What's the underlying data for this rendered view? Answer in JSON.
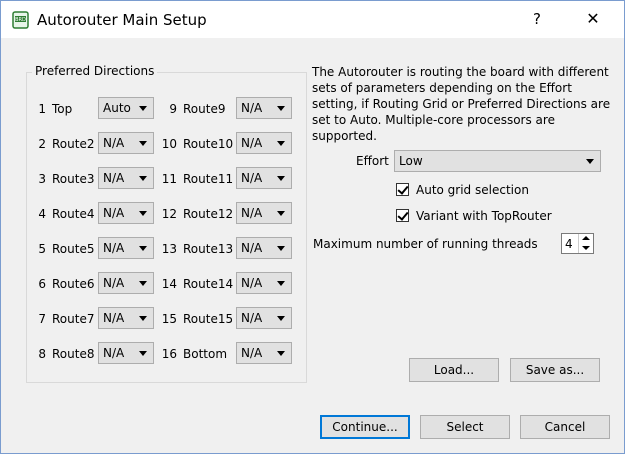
{
  "window": {
    "title": "Autorouter Main Setup",
    "help_label": "?",
    "close_label": "✕"
  },
  "preferred_directions": {
    "title": "Preferred Directions",
    "left_layers": [
      {
        "num": "1",
        "name": "Top",
        "value": "Auto"
      },
      {
        "num": "2",
        "name": "Route2",
        "value": "N/A"
      },
      {
        "num": "3",
        "name": "Route3",
        "value": "N/A"
      },
      {
        "num": "4",
        "name": "Route4",
        "value": "N/A"
      },
      {
        "num": "5",
        "name": "Route5",
        "value": "N/A"
      },
      {
        "num": "6",
        "name": "Route6",
        "value": "N/A"
      },
      {
        "num": "7",
        "name": "Route7",
        "value": "N/A"
      },
      {
        "num": "8",
        "name": "Route8",
        "value": "N/A"
      }
    ],
    "right_layers": [
      {
        "num": "9",
        "name": "Route9",
        "value": "N/A"
      },
      {
        "num": "10",
        "name": "Route10",
        "value": "N/A"
      },
      {
        "num": "11",
        "name": "Route11",
        "value": "N/A"
      },
      {
        "num": "12",
        "name": "Route12",
        "value": "N/A"
      },
      {
        "num": "13",
        "name": "Route13",
        "value": "N/A"
      },
      {
        "num": "14",
        "name": "Route14",
        "value": "N/A"
      },
      {
        "num": "15",
        "name": "Route15",
        "value": "N/A"
      },
      {
        "num": "16",
        "name": "Bottom",
        "value": "N/A"
      }
    ]
  },
  "description": "The Autorouter is routing the board with different sets of parameters depending on the Effort setting, if Routing Grid or Preferred Directions are set to Auto. Multiple-core processors are supported.",
  "effort": {
    "label": "Effort",
    "value": "Low"
  },
  "options": {
    "auto_grid": {
      "label": "Auto grid selection",
      "checked": true
    },
    "variant_toprouter": {
      "label": "Variant with TopRouter",
      "checked": true
    }
  },
  "threads": {
    "label": "Maximum number of running threads",
    "value": "4"
  },
  "buttons": {
    "load": "Load...",
    "save_as": "Save as...",
    "continue": "Continue...",
    "select": "Select",
    "cancel": "Cancel"
  },
  "icons": {
    "app": "brd-file-icon",
    "help": "help-icon",
    "close": "close-icon"
  },
  "colors": {
    "accent": "#0078d7",
    "app_icon": "#2e7d32"
  }
}
